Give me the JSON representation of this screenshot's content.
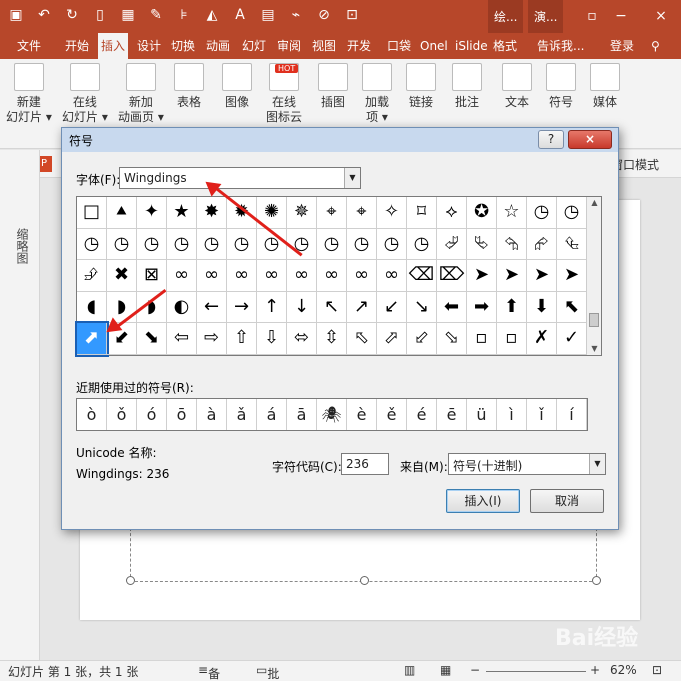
{
  "titlebar": {
    "context_tabs": [
      "绘...",
      "演..."
    ],
    "qat_icons": [
      "save-icon",
      "undo-icon",
      "redo-icon",
      "new-icon",
      "picture-icon",
      "eyedropper-icon",
      "align-icon",
      "fill-icon",
      "font-color-icon",
      "paste-icon",
      "brush-icon",
      "erase-icon",
      "select-icon"
    ],
    "accent": "#b7472a"
  },
  "tabs": [
    {
      "label": "文件"
    },
    {
      "label": "开始"
    },
    {
      "label": "插入",
      "active": true
    },
    {
      "label": "设计"
    },
    {
      "label": "切换"
    },
    {
      "label": "动画"
    },
    {
      "label": "幻灯"
    },
    {
      "label": "审阅"
    },
    {
      "label": "视图"
    },
    {
      "label": "开发"
    },
    {
      "label": "口袋"
    },
    {
      "label": "Onel"
    },
    {
      "label": "iSlide"
    },
    {
      "label": "格式"
    },
    {
      "label": "告诉我..."
    },
    {
      "label": "登录"
    }
  ],
  "ribbon": {
    "buttons": [
      {
        "line1": "新建",
        "line2": "幻灯片 ▾"
      },
      {
        "line1": "在线",
        "line2": "幻灯片 ▾"
      },
      {
        "line1": "新加",
        "line2": "动画页 ▾"
      },
      {
        "line1": "表格",
        "line2": ""
      },
      {
        "line1": "图像",
        "line2": ""
      },
      {
        "line1": "在线",
        "line2": "图标云"
      },
      {
        "line1": "插图",
        "line2": ""
      },
      {
        "line1": "加载",
        "line2": "项 ▾"
      },
      {
        "line1": "链接",
        "line2": ""
      },
      {
        "line1": "批注",
        "line2": ""
      },
      {
        "line1": "文本",
        "line2": ""
      },
      {
        "line1": "符号",
        "line2": ""
      },
      {
        "line1": "媒体",
        "line2": ""
      }
    ],
    "hot_badge": "HOT"
  },
  "workspace": {
    "outline_label": "缩略图",
    "window_mode": "窗口模式"
  },
  "dialog": {
    "title": "符号",
    "help_btn": "?",
    "close_btn": "×",
    "font_label": "字体(F):",
    "font_value": "Wingdings",
    "symbols": [
      "□",
      "⯅",
      "✦",
      "★",
      "✸",
      "✹",
      "✺",
      "✵",
      "⌖",
      "⌖",
      "✧",
      "⌑",
      "⟡",
      "✪",
      "☆",
      "◷",
      "◷",
      "◷",
      "◷",
      "◷",
      "◷",
      "◷",
      "◷",
      "◷",
      "◷",
      "◷",
      "◷",
      "◷",
      "◷",
      "⮰",
      "⮱",
      "⮲",
      "⮳",
      "⮴",
      "⮵",
      "✖",
      "⊠",
      "∞",
      "∞",
      "∞",
      "∞",
      "∞",
      "∞",
      "∞",
      "∞",
      "⌫",
      "⌦",
      "➤",
      "➤",
      "➤",
      "➤",
      "◖",
      "◗",
      "◗",
      "◐",
      "←",
      "→",
      "↑",
      "↓",
      "↖",
      "↗",
      "↙",
      "↘",
      "⬅",
      "➡",
      "⬆",
      "⬇",
      "⬉",
      "⬈",
      "⬋",
      "⬊",
      "⇦",
      "⇨",
      "⇧",
      "⇩",
      "⬄",
      "⇳",
      "⬁",
      "⬀",
      "⬃",
      "⬂",
      "▫",
      "▫",
      "✗",
      "✓"
    ],
    "selected_index": 68,
    "recent_label": "近期使用过的符号(R):",
    "recent": [
      "ò",
      "ǒ",
      "ó",
      "ō",
      "à",
      "ǎ",
      "á",
      "ā",
      "🕷",
      "è",
      "ě",
      "é",
      "ē",
      "ü",
      "ì",
      "ǐ",
      "í"
    ],
    "unicode_name_label": "Unicode 名称:",
    "char_name": "Wingdings: 236",
    "code_label": "字符代码(C):",
    "code_value": "236",
    "from_label": "来自(M):",
    "from_value": "符号(十进制)",
    "insert_label": "插入(I)",
    "cancel_label": "取消"
  },
  "statusbar": {
    "slide_info": "幻灯片 第 1 张，共 1 张",
    "notes": "备注",
    "comments": "批注",
    "zoom": "62%"
  },
  "watermark": "Bai经验"
}
